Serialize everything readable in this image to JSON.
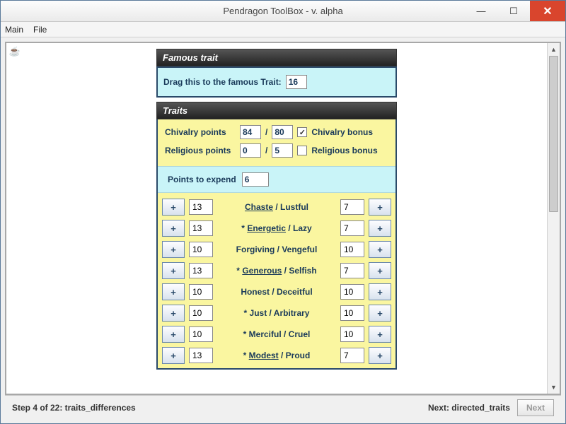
{
  "window": {
    "title": "Pendragon ToolBox - v. alpha"
  },
  "menu": {
    "main": "Main",
    "file": "File"
  },
  "famous": {
    "header": "Famous trait",
    "label": "Drag this to the famous Trait:",
    "value": "16"
  },
  "traits": {
    "header": "Traits",
    "chivalry_label": "Chivalry points",
    "chivalry_value": "84",
    "chivalry_max": "80",
    "chivalry_bonus_label": "Chivalry bonus",
    "chivalry_bonus_checked": true,
    "religious_label": "Religious points",
    "religious_value": "0",
    "religious_max": "5",
    "religious_bonus_label": "Religious bonus",
    "religious_bonus_checked": false,
    "slash": "/",
    "expend_label": "Points to expend",
    "expend_value": "6",
    "plus": "+",
    "rows": [
      {
        "lval": "13",
        "left": "Chaste",
        "right": "Lustful",
        "rval": "7",
        "star": false,
        "ul": true
      },
      {
        "lval": "13",
        "left": "Energetic",
        "right": "Lazy",
        "rval": "7",
        "star": true,
        "ul": true
      },
      {
        "lval": "10",
        "left": "Forgiving",
        "right": "Vengeful",
        "rval": "10",
        "star": false,
        "ul": false
      },
      {
        "lval": "13",
        "left": "Generous",
        "right": "Selfish",
        "rval": "7",
        "star": true,
        "ul": true
      },
      {
        "lval": "10",
        "left": "Honest",
        "right": "Deceitful",
        "rval": "10",
        "star": false,
        "ul": false
      },
      {
        "lval": "10",
        "left": "Just",
        "right": "Arbitrary",
        "rval": "10",
        "star": true,
        "ul": false
      },
      {
        "lval": "10",
        "left": "Merciful",
        "right": "Cruel",
        "rval": "10",
        "star": true,
        "ul": false
      },
      {
        "lval": "13",
        "left": "Modest",
        "right": "Proud",
        "rval": "7",
        "star": true,
        "ul": true
      }
    ]
  },
  "footer": {
    "step": "Step 4 of 22: traits_differences",
    "next_label": "Next: directed_traits",
    "next_button": "Next"
  }
}
